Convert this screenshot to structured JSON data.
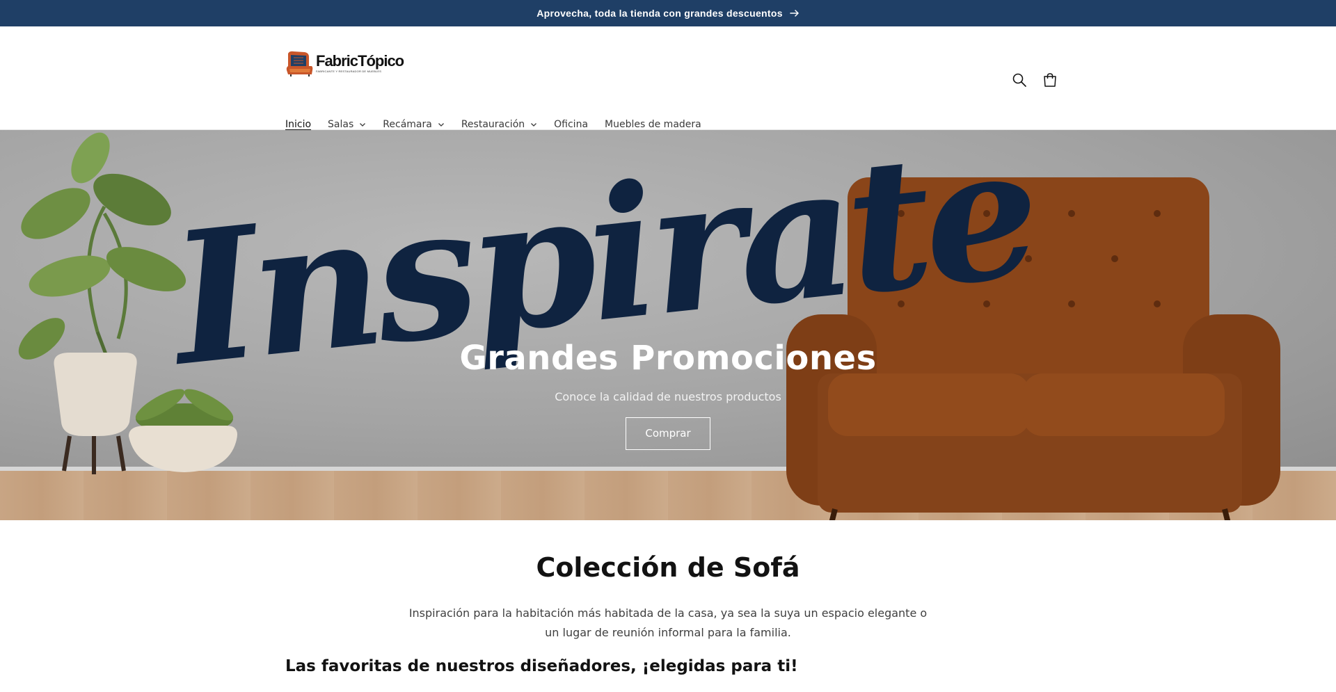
{
  "announcement": {
    "text": "Aprovecha, toda la tienda con grandes descuentos"
  },
  "logo": {
    "name": "FabricTópico",
    "tagline": "FABRICANTE Y RESTAURADOR DE MUEBLES"
  },
  "header": {
    "icons": [
      "search-icon",
      "cart-icon"
    ]
  },
  "nav": [
    {
      "label": "Inicio",
      "active": true,
      "has_dropdown": false
    },
    {
      "label": "Salas",
      "active": false,
      "has_dropdown": true
    },
    {
      "label": "Recámara",
      "active": false,
      "has_dropdown": true
    },
    {
      "label": "Restauración",
      "active": false,
      "has_dropdown": true
    },
    {
      "label": "Oficina",
      "active": false,
      "has_dropdown": false
    },
    {
      "label": "Muebles de madera",
      "active": false,
      "has_dropdown": false
    }
  ],
  "hero": {
    "script_text": "Inspirate",
    "title": "Grandes Promociones",
    "subtitle": "Conoce la calidad de nuestros productos",
    "button": "Comprar"
  },
  "collection": {
    "title": "Colección de Sofá",
    "description": "Inspiración para la habitación más habitada de la casa, ya sea la suya un espacio elegante o un lugar de reunión informal para la familia.",
    "favorites_heading": "Las favoritas de nuestros diseñadores, ¡elegidas para ti!"
  },
  "colors": {
    "announce_bg": "#1f3f66",
    "sofa": "#8a4519",
    "script": "#0f2340"
  }
}
